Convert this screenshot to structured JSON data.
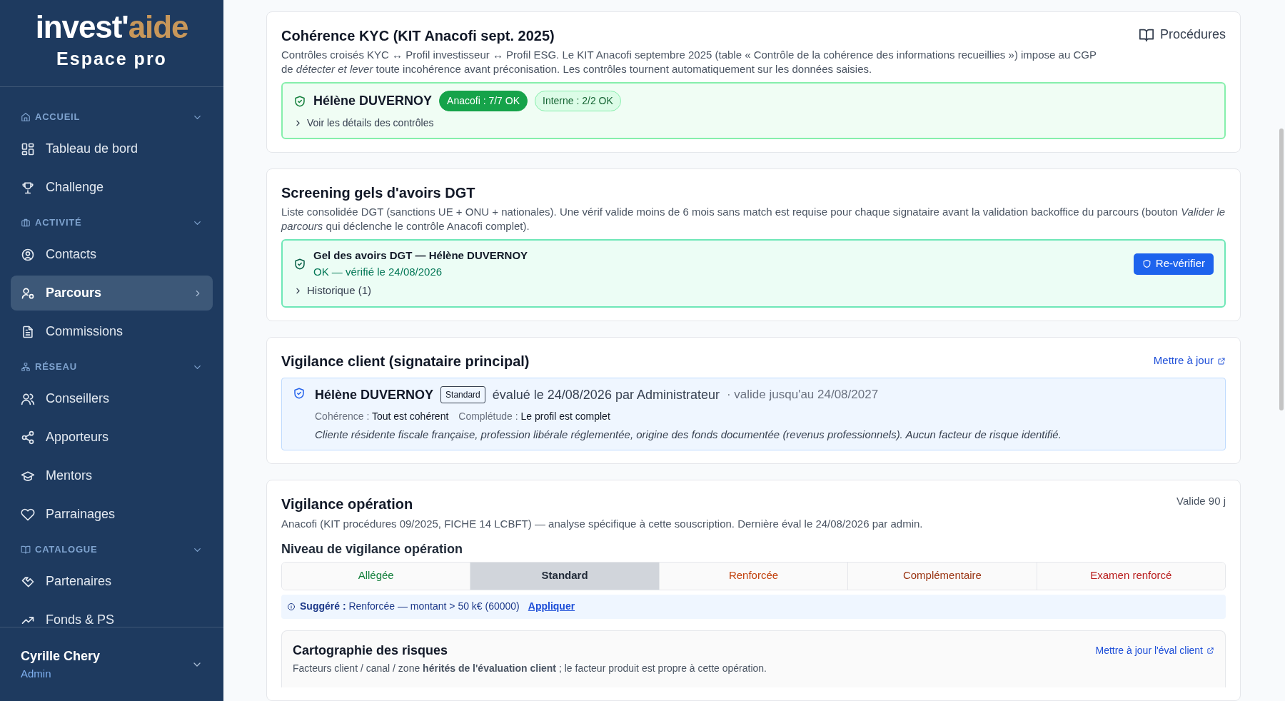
{
  "sidebar": {
    "logo": {
      "part1": "invest'",
      "part2": "aide"
    },
    "subtitle": "Espace pro",
    "sections": [
      {
        "label": "ACCUEIL",
        "expanded": true,
        "items": [
          {
            "label": "Tableau de bord",
            "selected": false
          },
          {
            "label": "Challenge",
            "selected": false
          }
        ]
      },
      {
        "label": "ACTIVITÉ",
        "expanded": true,
        "items": [
          {
            "label": "Contacts",
            "selected": false
          },
          {
            "label": "Parcours",
            "selected": true
          },
          {
            "label": "Commissions",
            "selected": false
          }
        ]
      },
      {
        "label": "RÉSEAU",
        "expanded": true,
        "items": [
          {
            "label": "Conseillers",
            "selected": false
          },
          {
            "label": "Apporteurs",
            "selected": false
          },
          {
            "label": "Mentors",
            "selected": false
          },
          {
            "label": "Parrainages",
            "selected": false
          }
        ]
      },
      {
        "label": "CATALOGUE",
        "expanded": true,
        "items": [
          {
            "label": "Partenaires",
            "selected": false
          },
          {
            "label": "Fonds & PS",
            "selected": false
          }
        ]
      }
    ],
    "user": {
      "name": "Cyrille Chery",
      "role": "Admin"
    }
  },
  "kyc": {
    "title": "Cohérence KYC (KIT Anacofi sept. 2025)",
    "link": "Procédures",
    "description": "Contrôles croisés KYC ↔ Profil investisseur ↔ Profil ESG. Le KIT Anacofi septembre 2025 (table « Contrôle de la cohérence des informations recueillies ») impose au CGP de *détecter et lever* toute incohérence avant préconisation. Les contrôles tournent automatiquement sur les données saisies.",
    "person": "Hélène DUVERNOY",
    "badges": [
      {
        "label": "Anacofi : 7/7 OK",
        "kind": "solid"
      },
      {
        "label": "Interne : 2/2 OK",
        "kind": "outline"
      }
    ],
    "details": "Voir les détails des contrôles",
    "expanded": false
  },
  "dgt": {
    "title": "Screening gels d'avoirs DGT",
    "description": "Liste consolidée DGT (sanctions UE + ONU + nationales). Une vérif valide moins de 6 mois sans match est requise pour chaque signataire avant la validation backoffice du parcours (bouton *Valider le parcours* qui déclenche le contrôle Anacofi complet).",
    "result_title": "Gel des avoirs DGT — Hélène DUVERNOY",
    "result_status": "OK — vérifié le 24/08/2026",
    "button": "Re-vérifier",
    "history": "Historique (1)",
    "expanded": false
  },
  "client_vigilance": {
    "title": "Vigilance client (signataire principal)",
    "link": "Mettre à jour",
    "person": "Hélène DUVERNOY",
    "level": "Standard",
    "evaluated": "évalué le 24/08/2026 par Administrateur",
    "valid_until": "· valide jusqu'au 24/08/2027",
    "coherence_label": "Cohérence :",
    "coherence": "Tout est cohérent",
    "completude_label": "Complétude :",
    "completude": "Le profil est complet",
    "comment": "Cliente résidente fiscale française, profession libérale réglementée, origine des fonds documentée (revenus professionnels). Aucun facteur de risque identifié."
  },
  "operation_vigilance": {
    "title": "Vigilance opération",
    "validity": "Valide 90 j",
    "description": "Anacofi (KIT procédures 09/2025, FICHE 14 LCBFT) — analyse spécifique à cette souscription. Dernière éval le 24/08/2026 par admin.",
    "level_heading": "Niveau de vigilance opération",
    "levels": [
      {
        "label": "Allégée",
        "color": "#15803d",
        "selected": false
      },
      {
        "label": "Standard",
        "color": "#1f2937",
        "selected": true
      },
      {
        "label": "Renforcée",
        "color": "#c2410c",
        "selected": false
      },
      {
        "label": "Complémentaire",
        "color": "#9a3412",
        "selected": false
      },
      {
        "label": "Examen renforcé",
        "color": "#b91c1c",
        "selected": false
      }
    ],
    "suggestion": "**Suggéré :** Renforcée — montant > 50 k€ (60000)",
    "apply": "Appliquer",
    "risk_map": {
      "title": "Cartographie des risques",
      "link": "Mettre à jour l'éval client",
      "description": "Facteurs client / canal / zone **hérités de l'évaluation client** ; le facteur produit est propre à cette opération."
    }
  }
}
